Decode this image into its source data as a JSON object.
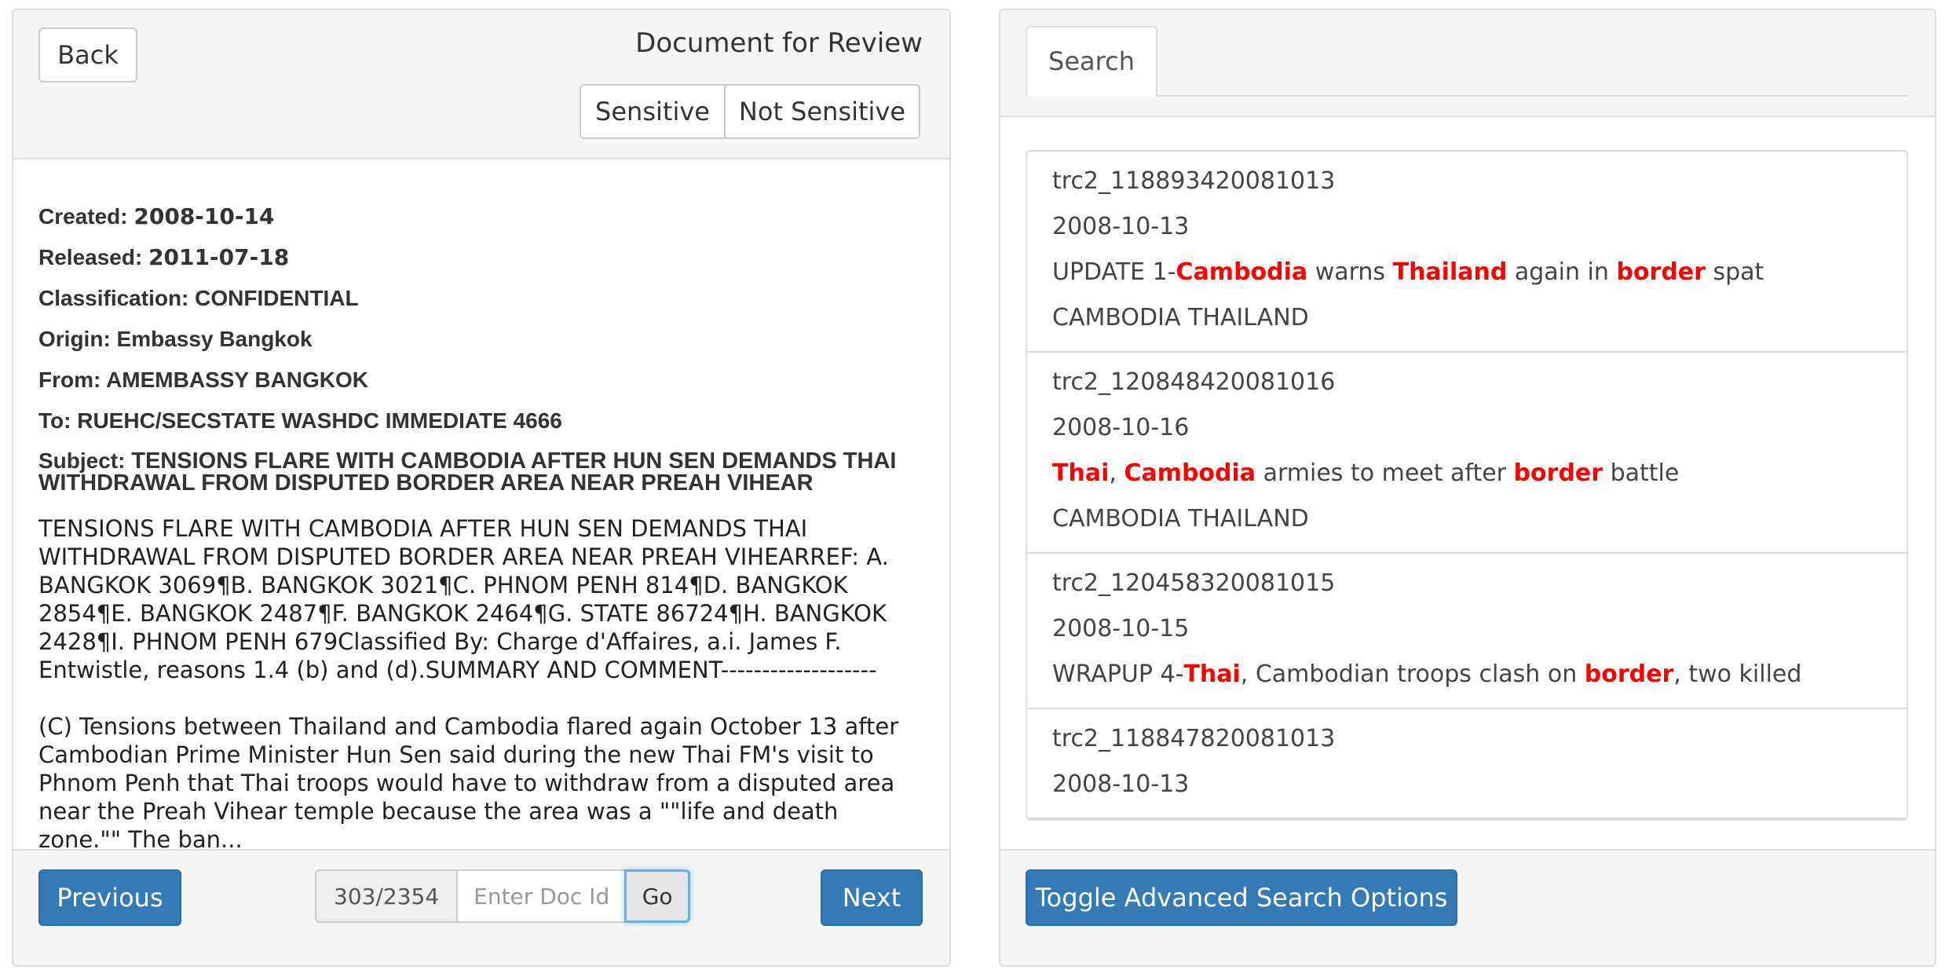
{
  "review": {
    "back_label": "Back",
    "title": "Document for Review",
    "sensitive_label": "Sensitive",
    "not_sensitive_label": "Not Sensitive"
  },
  "document": {
    "created_label": "Created:",
    "created": "2008-10-14",
    "released_label": "Released:",
    "released": "2011-07-18",
    "classification_label": "Classification:",
    "classification": "CONFIDENTIAL",
    "origin_label": "Origin:",
    "origin": "Embassy Bangkok",
    "from_label": "From:",
    "from": "AMEMBASSY BANGKOK",
    "to_label": "To:",
    "to": "RUEHC/SECSTATE WASHDC IMMEDIATE 4666",
    "subject_label": "Subject:",
    "subject": "TENSIONS FLARE WITH CAMBODIA AFTER HUN SEN DEMANDS THAI WITHDRAWAL FROM DISPUTED BORDER AREA NEAR PREAH VIHEAR",
    "body_para1": "TENSIONS FLARE WITH CAMBODIA AFTER HUN SEN DEMANDS THAI WITHDRAWAL FROM DISPUTED BORDER AREA NEAR PREAH VIHEARREF: A. BANGKOK 3069¶B. BANGKOK 3021¶C. PHNOM PENH 814¶D. BANGKOK 2854¶E. BANGKOK 2487¶F. BANGKOK 2464¶G. STATE 86724¶H. BANGKOK 2428¶I. PHNOM PENH 679Classified By: Charge d'Affaires, a.i. James F. Entwistle, reasons 1.4 (b) and (d).SUMMARY AND COMMENT-------------------",
    "body_para2": "(C) Tensions between Thailand and Cambodia flared again October 13 after Cambodian Prime Minister Hun Sen said during the new Thai FM's visit to Phnom Penh that Thai troops would have to withdraw from a disputed area near the Preah Vihear temple because the area was a \"\"life and death zone.\"\" The ban..."
  },
  "pager": {
    "previous_label": "Previous",
    "counter": "303/2354",
    "doc_id_placeholder": "Enter Doc Id",
    "go_label": "Go",
    "next_label": "Next"
  },
  "search": {
    "tab_label": "Search",
    "advanced_toggle_label": "Toggle Advanced Search Options",
    "highlight_color": "#ff0000",
    "results": [
      {
        "id": "trc2_118893420081013",
        "date": "2008-10-13",
        "headline": [
          {
            "text": "UPDATE 1-",
            "hl": false
          },
          {
            "text": "Cambodia",
            "hl": true
          },
          {
            "text": " warns ",
            "hl": false
          },
          {
            "text": "Thailand",
            "hl": true
          },
          {
            "text": " again in ",
            "hl": false
          },
          {
            "text": "border",
            "hl": true
          },
          {
            "text": " spat",
            "hl": false
          }
        ],
        "tags": "CAMBODIA THAILAND"
      },
      {
        "id": "trc2_120848420081016",
        "date": "2008-10-16",
        "headline": [
          {
            "text": "Thai",
            "hl": true
          },
          {
            "text": ", ",
            "hl": false
          },
          {
            "text": "Cambodia",
            "hl": true
          },
          {
            "text": " armies to meet after ",
            "hl": false
          },
          {
            "text": "border",
            "hl": true
          },
          {
            "text": " battle",
            "hl": false
          }
        ],
        "tags": "CAMBODIA THAILAND"
      },
      {
        "id": "trc2_120458320081015",
        "date": "2008-10-15",
        "headline": [
          {
            "text": "WRAPUP 4-",
            "hl": false
          },
          {
            "text": "Thai",
            "hl": true
          },
          {
            "text": ", Cambodian troops clash on ",
            "hl": false
          },
          {
            "text": "border",
            "hl": true
          },
          {
            "text": ", two killed",
            "hl": false
          }
        ],
        "tags": ""
      },
      {
        "id": "trc2_118847820081013",
        "date": "2008-10-13",
        "headline": [],
        "tags": ""
      }
    ]
  }
}
